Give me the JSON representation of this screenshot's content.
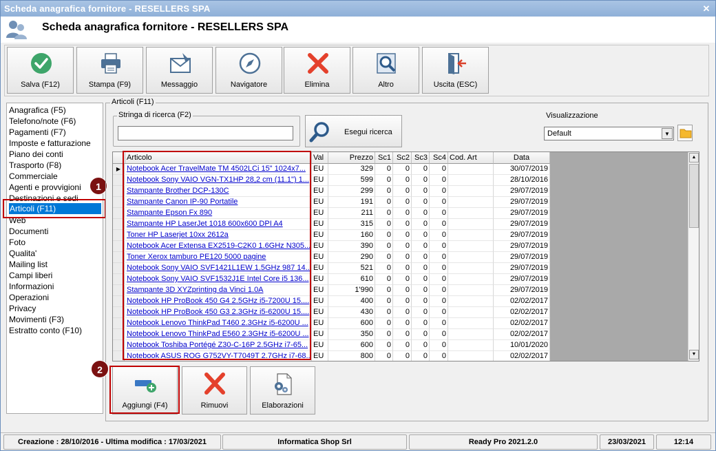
{
  "window": {
    "title": "Scheda anagrafica fornitore - RESELLERS SPA",
    "close": "✕"
  },
  "header": {
    "title": "Scheda anagrafica fornitore - RESELLERS SPA"
  },
  "toolbar": [
    {
      "label": "Salva (F12)",
      "icon": "check-icon"
    },
    {
      "label": "Stampa (F9)",
      "icon": "printer-icon"
    },
    {
      "label": "Messaggio",
      "icon": "message-icon"
    },
    {
      "label": "Navigatore",
      "icon": "compass-icon"
    },
    {
      "label": "Elimina",
      "icon": "delete-icon"
    },
    {
      "label": "Altro",
      "icon": "magnifier-icon"
    },
    {
      "label": "Uscita (ESC)",
      "icon": "exit-icon"
    }
  ],
  "sidebar": {
    "items": [
      "Anagrafica (F5)",
      "Telefono/note (F6)",
      "Pagamenti (F7)",
      "Imposte e fatturazione",
      "Piano dei conti",
      "Trasporto (F8)",
      "Commerciale",
      "Agenti e provvigioni",
      "Destinazioni e sedi",
      "Articoli (F11)",
      "Web",
      "Documenti",
      "Foto",
      "Qualita'",
      "Mailing list",
      "Campi liberi",
      "Informazioni",
      "Operazioni",
      "Privacy",
      "Movimenti (F3)",
      "Estratto conto (F10)"
    ],
    "selected": "Articoli (F11)"
  },
  "markers": {
    "one": "1",
    "two": "2"
  },
  "group": {
    "label": "Articoli (F11)"
  },
  "search": {
    "label": "Stringa di ricerca (F2)",
    "value": "",
    "button": "Esegui ricerca"
  },
  "view": {
    "label": "Visualizzazione",
    "value": "Default"
  },
  "grid": {
    "columns": [
      "Articolo",
      "Val",
      "Prezzo",
      "Sc1",
      "Sc2",
      "Sc3",
      "Sc4",
      "Cod. Art",
      "Data"
    ],
    "rows": [
      [
        "Notebook Acer TravelMate TM 4502LCi 15\" 1024x7...",
        "EU",
        "329",
        "0",
        "0",
        "0",
        "0",
        "",
        "30/07/2019"
      ],
      [
        "Notebook Sony VAIO VGN-TX1HP 28,2 cm (11.1\") 1...",
        "EU",
        "599",
        "0",
        "0",
        "0",
        "0",
        "",
        "28/10/2016"
      ],
      [
        "Stampante Brother DCP-130C",
        "EU",
        "299",
        "0",
        "0",
        "0",
        "0",
        "",
        "29/07/2019"
      ],
      [
        "Stampante Canon IP-90 Portatile",
        "EU",
        "191",
        "0",
        "0",
        "0",
        "0",
        "",
        "29/07/2019"
      ],
      [
        "Stampante Epson Fx 890",
        "EU",
        "211",
        "0",
        "0",
        "0",
        "0",
        "",
        "29/07/2019"
      ],
      [
        "Stampante HP LaserJet 1018 600x600 DPI A4",
        "EU",
        "315",
        "0",
        "0",
        "0",
        "0",
        "",
        "29/07/2019"
      ],
      [
        "Toner HP Laserjet 10xx 2612a",
        "EU",
        "160",
        "0",
        "0",
        "0",
        "0",
        "",
        "29/07/2019"
      ],
      [
        "Notebook Acer Extensa EX2519-C2K0 1.6GHz N305...",
        "EU",
        "390",
        "0",
        "0",
        "0",
        "0",
        "",
        "29/07/2019"
      ],
      [
        "Toner Xerox tamburo PE120 5000 pagine",
        "EU",
        "290",
        "0",
        "0",
        "0",
        "0",
        "",
        "29/07/2019"
      ],
      [
        "Notebook Sony VAIO SVF1421L1EW 1.5GHz 987 14...",
        "EU",
        "521",
        "0",
        "0",
        "0",
        "0",
        "",
        "29/07/2019"
      ],
      [
        "Notebook Sony VAIO SVF1532J1E Intel Core i5 136...",
        "EU",
        "610",
        "0",
        "0",
        "0",
        "0",
        "",
        "29/07/2019"
      ],
      [
        "Stampante 3D XYZprinting da Vinci 1.0A",
        "EU",
        "1'990",
        "0",
        "0",
        "0",
        "0",
        "",
        "29/07/2019"
      ],
      [
        "Notebook HP ProBook 450 G4 2.5GHz i5-7200U 15....",
        "EU",
        "400",
        "0",
        "0",
        "0",
        "0",
        "",
        "02/02/2017"
      ],
      [
        "Notebook HP ProBook 450 G3 2.3GHz i5-6200U 15....",
        "EU",
        "430",
        "0",
        "0",
        "0",
        "0",
        "",
        "02/02/2017"
      ],
      [
        "Notebook Lenovo ThinkPad T460 2.3GHz i5-6200U ...",
        "EU",
        "600",
        "0",
        "0",
        "0",
        "0",
        "",
        "02/02/2017"
      ],
      [
        "Notebook Lenovo ThinkPad E560 2.3GHz i5-6200U ...",
        "EU",
        "350",
        "0",
        "0",
        "0",
        "0",
        "",
        "02/02/2017"
      ],
      [
        "Notebook Toshiba Portégé Z30-C-16P 2.5GHz i7-65...",
        "EU",
        "600",
        "0",
        "0",
        "0",
        "0",
        "",
        "10/01/2020"
      ],
      [
        "Notebook ASUS ROG G752VY-T7049T 2.7GHz i7-68...",
        "EU",
        "800",
        "0",
        "0",
        "0",
        "0",
        "",
        "02/02/2017"
      ]
    ]
  },
  "actions": [
    {
      "label": "Aggiungi (F4)",
      "icon": "add-item-icon"
    },
    {
      "label": "Rimuovi",
      "icon": "remove-icon"
    },
    {
      "label": "Elaborazioni",
      "icon": "document-gear-icon"
    }
  ],
  "status": {
    "dates": "Creazione : 28/10/2016 - Ultima modifica : 17/03/2021",
    "company": "Informatica Shop Srl",
    "product": "Ready Pro 2021.2.0",
    "date": "23/03/2021",
    "time": "12:14"
  },
  "colors": {
    "title_bar": "#9dbbe0",
    "selection": "#0078d7",
    "link": "#0000cc",
    "highlight": "#c00000",
    "badge": "#7b1111"
  }
}
